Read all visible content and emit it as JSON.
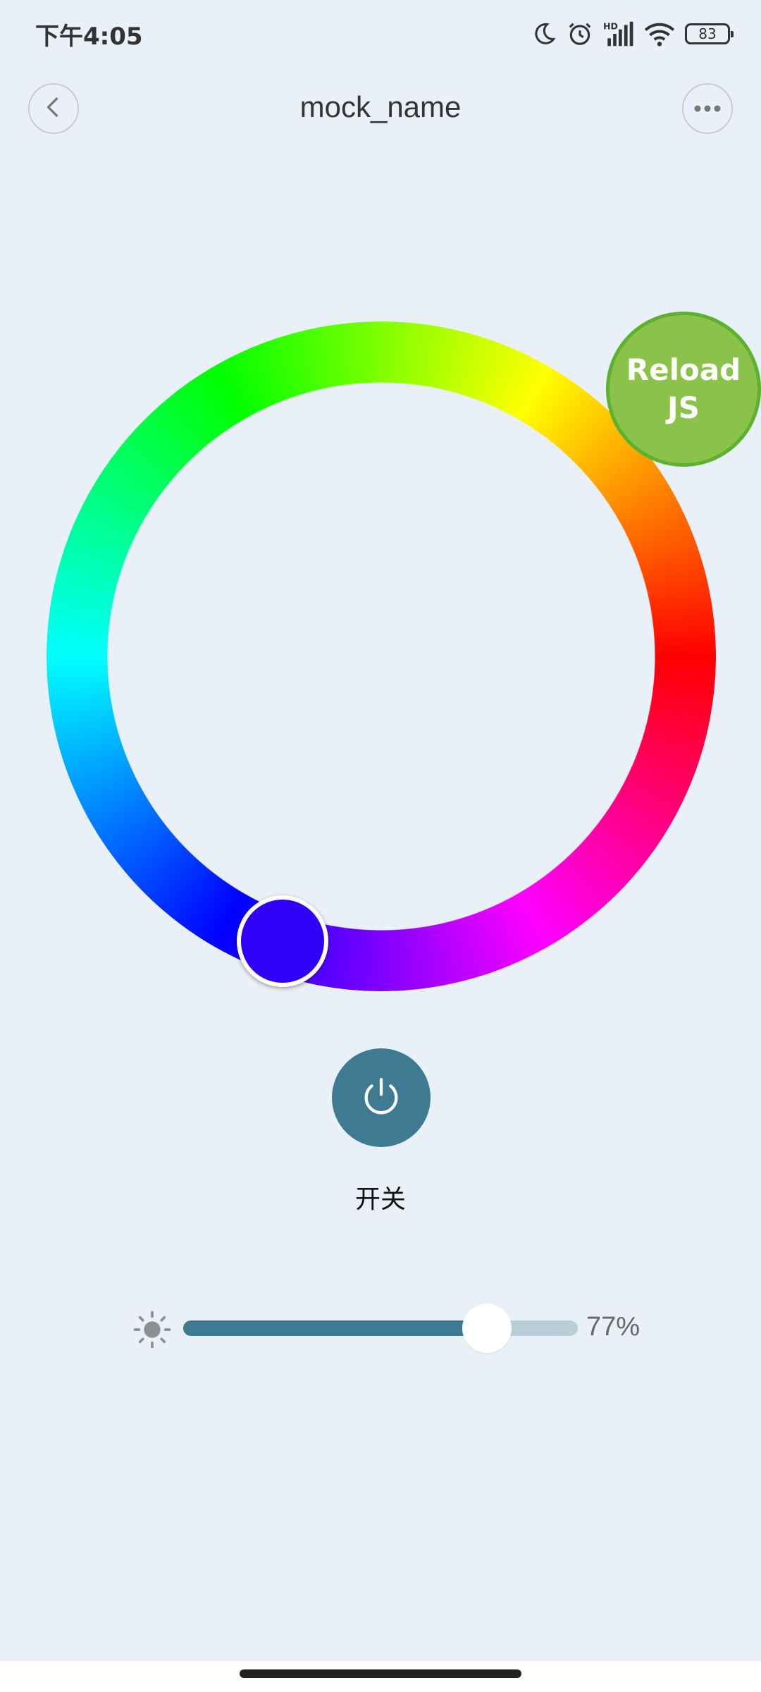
{
  "status_bar": {
    "time": "下午4:05",
    "battery": "83",
    "icons": [
      "moon-icon",
      "alarm-icon",
      "hd-signal-icon",
      "wifi-icon",
      "battery-icon"
    ]
  },
  "header": {
    "title": "mock_name",
    "back_icon": "chevron-left-icon",
    "more_icon": "more-dots-icon"
  },
  "color_wheel": {
    "selected_color": "#2e00f5",
    "hue_stops": [
      "#ff0000",
      "#ff00ff",
      "#0000ff",
      "#00ffff",
      "#00ff00",
      "#ffff00"
    ]
  },
  "reload": {
    "line1": "Reload",
    "line2": "JS",
    "color": "#8bc34a"
  },
  "power": {
    "label": "开关",
    "icon": "power-icon",
    "color": "#3e7a91"
  },
  "brightness": {
    "icon": "sun-icon",
    "value": 77,
    "value_text": "77%",
    "fill_color": "#3e7a91",
    "track_color": "#b8ced9"
  }
}
